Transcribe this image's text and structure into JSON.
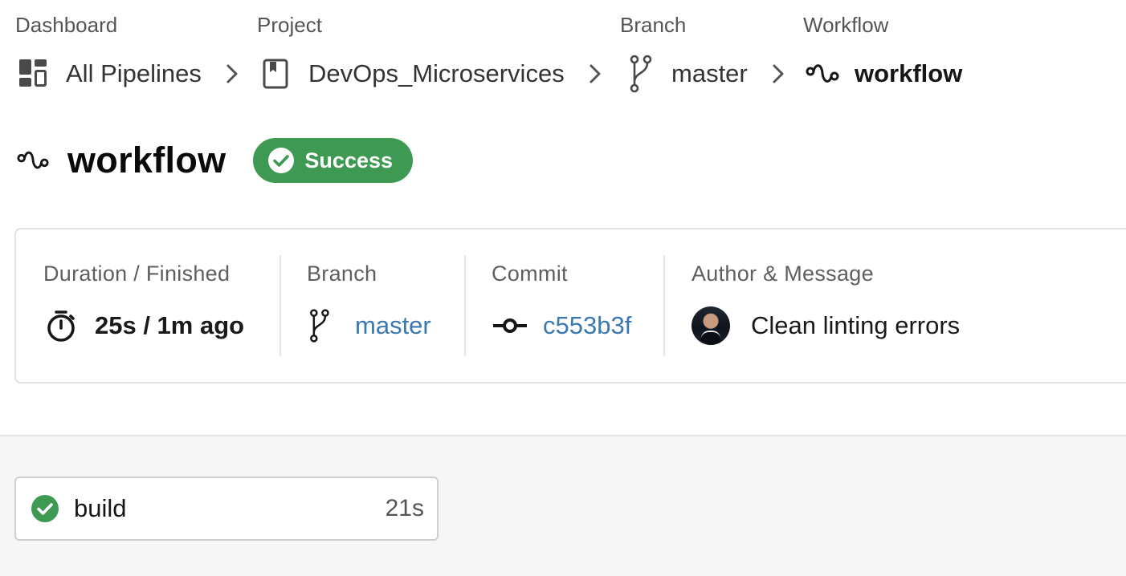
{
  "breadcrumb": {
    "dashboard": {
      "category": "Dashboard",
      "label": "All Pipelines",
      "icon": "dashboard-icon"
    },
    "project": {
      "category": "Project",
      "label": "DevOps_Microservices",
      "icon": "repo-icon"
    },
    "branch": {
      "category": "Branch",
      "label": "master",
      "icon": "branch-icon"
    },
    "workflow": {
      "category": "Workflow",
      "label": "workflow",
      "icon": "workflow-icon"
    },
    "separator_icon": "chevron-right-icon"
  },
  "header": {
    "title": "workflow",
    "status": "Success",
    "status_color": "#3e9a52"
  },
  "details": {
    "duration": {
      "label": "Duration / Finished",
      "value": "25s / 1m ago",
      "icon": "stopwatch-icon"
    },
    "branch": {
      "label": "Branch",
      "value": "master",
      "icon": "branch-icon"
    },
    "commit": {
      "label": "Commit",
      "value": "c553b3f",
      "icon": "commit-icon"
    },
    "author": {
      "label": "Author & Message",
      "message": "Clean linting errors"
    },
    "link_color": "#3a79b0"
  },
  "jobs": [
    {
      "name": "build",
      "duration": "21s",
      "status": "success"
    }
  ]
}
